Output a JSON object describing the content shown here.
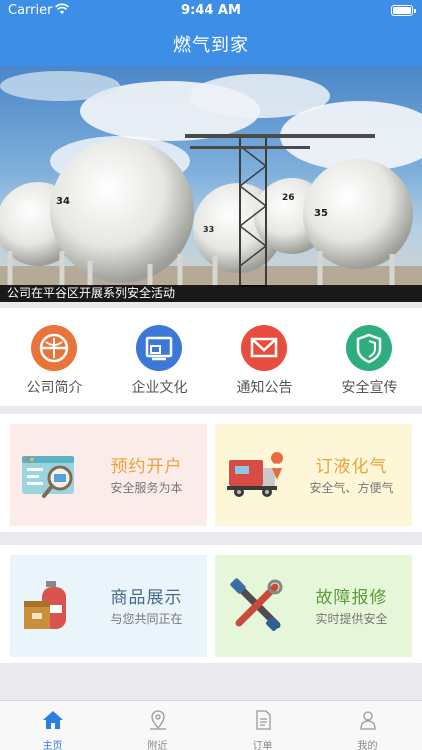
{
  "status_bar": {
    "carrier": "Carrier",
    "time": "9:44 AM"
  },
  "nav": {
    "title": "燃气到家"
  },
  "banner": {
    "caption": "公司在平谷区开展系列安全活动",
    "tank_numbers": [
      "34",
      "33",
      "26",
      "35"
    ]
  },
  "quick_menu": [
    {
      "label": "公司简介",
      "icon": "company-logo-icon",
      "color": "#e8743b"
    },
    {
      "label": "企业文化",
      "icon": "monitor-icon",
      "color": "#3c78d8"
    },
    {
      "label": "通知公告",
      "icon": "envelope-icon",
      "color": "#e84c3d"
    },
    {
      "label": "安全宣传",
      "icon": "shield-icon",
      "color": "#2eae7f"
    }
  ],
  "services": [
    {
      "title": "预约开户",
      "subtitle": "安全服务为本",
      "title_color": "#e8a33c",
      "bg": "#fbece9",
      "icon": "browser-search-icon"
    },
    {
      "title": "订液化气",
      "subtitle": "安全气、方便气",
      "title_color": "#e8a33c",
      "bg": "#fdf7d7",
      "icon": "truck-location-icon"
    },
    {
      "title": "商品展示",
      "subtitle": "与您共同正在",
      "title_color": "#4c6a86",
      "bg": "#e9f4fb",
      "icon": "gas-cylinder-box-icon"
    },
    {
      "title": "故障报修",
      "subtitle": "实时提供安全",
      "title_color": "#5d9c3a",
      "bg": "#e6f7d9",
      "icon": "tools-icon"
    }
  ],
  "tabbar": {
    "tabs": [
      {
        "label": "主页",
        "icon": "home-icon",
        "active": true
      },
      {
        "label": "附近",
        "icon": "location-pin-icon",
        "active": false
      },
      {
        "label": "订单",
        "icon": "document-icon",
        "active": false
      },
      {
        "label": "我的",
        "icon": "person-icon",
        "active": false
      }
    ],
    "active_color": "#2a7fe0"
  }
}
